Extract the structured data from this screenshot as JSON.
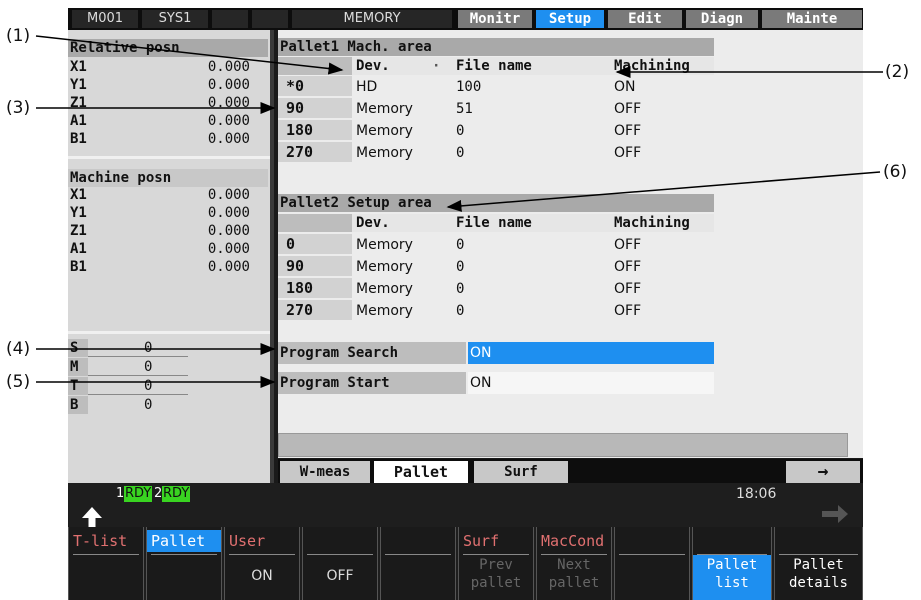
{
  "topbar": {
    "machine": "M001",
    "system": "SYS1",
    "mode": "MEMORY",
    "tabs": [
      "Monitr",
      "Setup",
      "Edit",
      "Diagn",
      "Mainte"
    ],
    "active_tab": "Setup"
  },
  "left": {
    "relative_title": "Relative posn",
    "relative": [
      {
        "axis": "X1",
        "value": "0.000"
      },
      {
        "axis": "Y1",
        "value": "0.000"
      },
      {
        "axis": "Z1",
        "value": "0.000"
      },
      {
        "axis": "A1",
        "value": "0.000"
      },
      {
        "axis": "B1",
        "value": "0.000"
      }
    ],
    "machine_title": "Machine posn",
    "machine": [
      {
        "axis": "X1",
        "value": "0.000"
      },
      {
        "axis": "Y1",
        "value": "0.000"
      },
      {
        "axis": "Z1",
        "value": "0.000"
      },
      {
        "axis": "A1",
        "value": "0.000"
      },
      {
        "axis": "B1",
        "value": "0.000"
      }
    ],
    "smtb": [
      {
        "key": "S",
        "value": "0"
      },
      {
        "key": "M",
        "value": "0"
      },
      {
        "key": "T",
        "value": "0"
      },
      {
        "key": "B",
        "value": "0"
      }
    ]
  },
  "pallet1": {
    "title": "Pallet1  Mach. area",
    "col_dev": "Dev.",
    "col_file": "File name",
    "col_mach": "Machining",
    "rows": [
      {
        "angle": "*0",
        "dev": "HD",
        "file": "100",
        "mach": "ON"
      },
      {
        "angle": "90",
        "dev": "Memory",
        "file": "51",
        "mach": "OFF"
      },
      {
        "angle": "180",
        "dev": "Memory",
        "file": "0",
        "mach": "OFF"
      },
      {
        "angle": "270",
        "dev": "Memory",
        "file": "0",
        "mach": "OFF"
      }
    ]
  },
  "pallet2": {
    "title": "Pallet2  Setup area",
    "col_dev": "Dev.",
    "col_file": "File name",
    "col_mach": "Machining",
    "rows": [
      {
        "angle": "0",
        "dev": "Memory",
        "file": "0",
        "mach": "OFF"
      },
      {
        "angle": "90",
        "dev": "Memory",
        "file": "0",
        "mach": "OFF"
      },
      {
        "angle": "180",
        "dev": "Memory",
        "file": "0",
        "mach": "OFF"
      },
      {
        "angle": "270",
        "dev": "Memory",
        "file": "0",
        "mach": "OFF"
      }
    ]
  },
  "settings": {
    "search_label": "Program Search",
    "search_value": "ON",
    "start_label": "Program Start",
    "start_value": "ON"
  },
  "screen_tabs": [
    "W-meas",
    "Pallet",
    "Surf"
  ],
  "status": {
    "rdy1_num": "1",
    "rdy1": "RDY",
    "rdy2_num": "2",
    "rdy2": "RDY",
    "clock": "18:06"
  },
  "fkeys": [
    {
      "top": "T-list",
      "l1": "",
      "l2": ""
    },
    {
      "top": "Pallet",
      "l1": "",
      "l2": ""
    },
    {
      "top": "User",
      "l1": "",
      "l2": "ON"
    },
    {
      "top": "",
      "l1": "",
      "l2": "OFF"
    },
    {
      "top": "",
      "l1": "",
      "l2": ""
    },
    {
      "top": "Surf",
      "l1": "Prev",
      "l2": "pallet"
    },
    {
      "top": "MacCond",
      "l1": "Next",
      "l2": "pallet"
    },
    {
      "top": "",
      "l1": "",
      "l2": ""
    },
    {
      "top": "",
      "l1": "Pallet",
      "l2": "list"
    },
    {
      "top": "",
      "l1": "Pallet",
      "l2": "details"
    }
  ],
  "callouts": [
    "(1)",
    "(2)",
    "(3)",
    "(4)",
    "(5)",
    "(6)"
  ],
  "colors": {
    "accent_blue": "#1e8ff0",
    "ready_green": "#39d421",
    "header_gray": "#a9a9a9"
  }
}
